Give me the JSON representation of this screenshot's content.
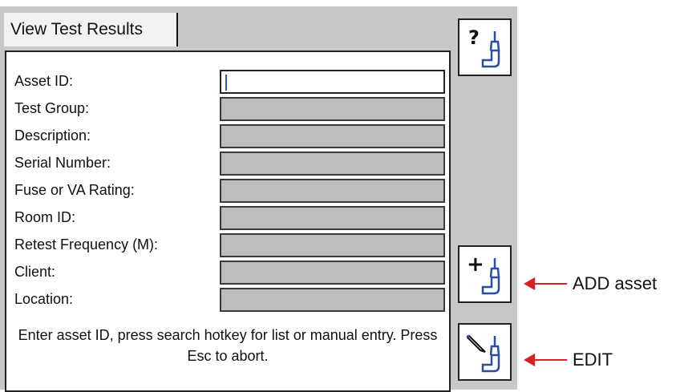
{
  "tab": {
    "label": "View Test Results"
  },
  "form": {
    "fields": [
      {
        "label": "Asset ID:",
        "value": ""
      },
      {
        "label": "Test Group:",
        "value": ""
      },
      {
        "label": "Description:",
        "value": ""
      },
      {
        "label": "Serial Number:",
        "value": ""
      },
      {
        "label": "Fuse or VA Rating:",
        "value": ""
      },
      {
        "label": "Room ID:",
        "value": ""
      },
      {
        "label": "Retest Frequency (M):",
        "value": ""
      },
      {
        "label": "Client:",
        "value": ""
      },
      {
        "label": "Location:",
        "value": ""
      }
    ],
    "hint": "Enter asset ID, press search hotkey for list or manual entry. Press Esc to abort."
  },
  "softkeys": {
    "help": {
      "icon": "help-probe-icon",
      "glyph": "?"
    },
    "add": {
      "icon": "add-probe-icon",
      "glyph": "+"
    },
    "edit": {
      "icon": "edit-probe-icon"
    }
  },
  "annotations": {
    "add": "ADD asset",
    "edit": "EDIT"
  },
  "colors": {
    "arrow": "#d81f26",
    "caret": "#2a5cc8",
    "probe": "#2b4da8"
  }
}
